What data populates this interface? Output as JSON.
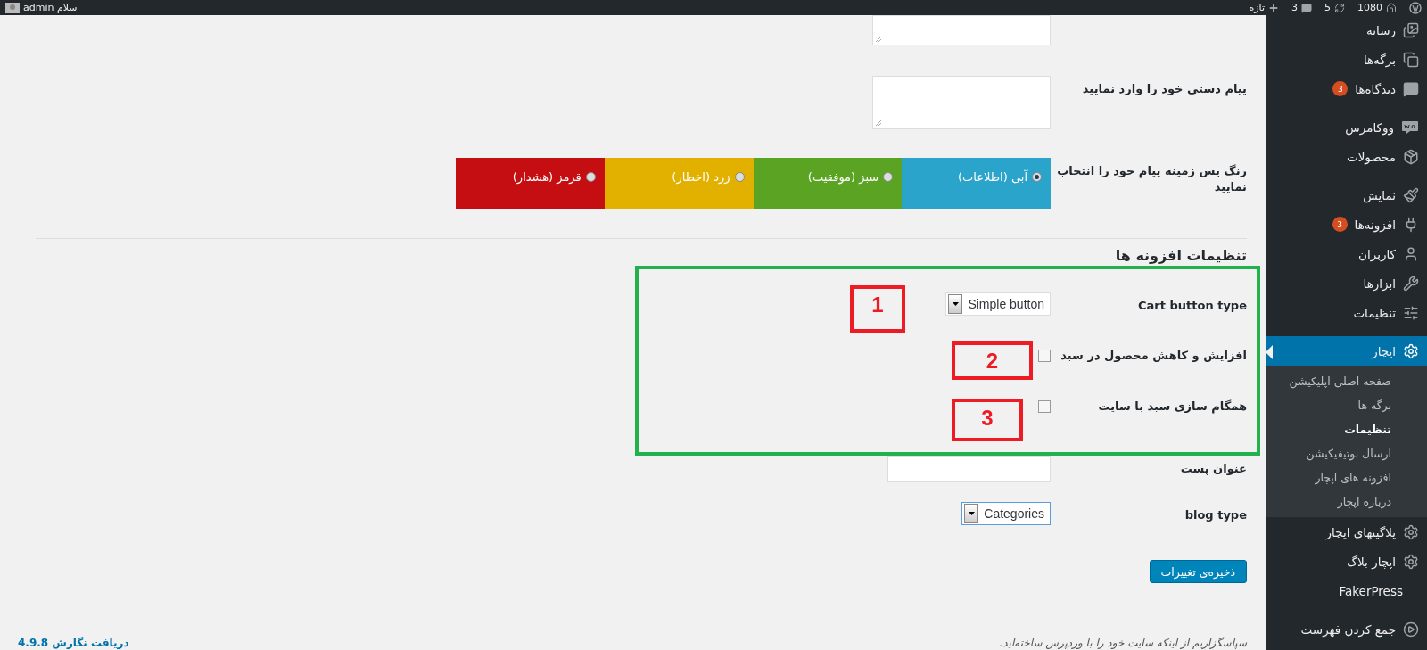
{
  "admin_bar": {
    "site": "1080",
    "updates": "5",
    "comments": "3",
    "new": "تازه",
    "greeting": "سلام admin"
  },
  "sidebar": {
    "groups": [
      {
        "items": [
          {
            "label": "رسانه",
            "selected": false
          },
          {
            "label": "برگه‌ها",
            "selected": false
          },
          {
            "label": "دیدگاه‌ها",
            "badge": "3",
            "selected": false
          }
        ]
      },
      {
        "items": [
          {
            "label": "ووکامرس",
            "selected": false
          },
          {
            "label": "محصولات",
            "selected": false
          }
        ]
      },
      {
        "items": [
          {
            "label": "نمایش",
            "selected": false
          },
          {
            "label": "افزونه‌ها",
            "badge": "3",
            "selected": false
          },
          {
            "label": "کاربران",
            "selected": false
          },
          {
            "label": "ابزارها",
            "selected": false
          },
          {
            "label": "تنظیمات",
            "selected": false
          }
        ]
      },
      {
        "items": [
          {
            "label": "اپچار",
            "selected": true,
            "children": [
              {
                "label": "صفحه اصلی اپلیکیشن",
                "selected": false
              },
              {
                "label": "برگه ها",
                "selected": false
              },
              {
                "label": "تنظیمات",
                "selected": true
              },
              {
                "label": "ارسال نوتیفیکیشن",
                "selected": false
              },
              {
                "label": "افزونه های اپچار",
                "selected": false
              },
              {
                "label": "درباره اپچار",
                "selected": false
              }
            ]
          },
          {
            "label": "پلاگینهای اپچار",
            "selected": false
          },
          {
            "label": "اپچار بلاگ",
            "selected": false
          },
          {
            "label": "FakerPress",
            "selected": false
          }
        ]
      }
    ],
    "collapse": "جمع کردن فهرست"
  },
  "form": {
    "message_label": "پیام دستی خود را وارد نمایید",
    "color_label": "رنگ پس زمینه پیام خود را انتخاب نمایید",
    "colors": [
      {
        "label": "آبی (اطلاعات)",
        "color": "#2ba4cc",
        "selected": true
      },
      {
        "label": "سبز (موفقیت)",
        "color": "#5ba423",
        "selected": false
      },
      {
        "label": "زرد (اخطار)",
        "color": "#e2b100",
        "selected": false
      },
      {
        "label": "قرمز (هشدار)",
        "color": "#c40e12",
        "selected": false
      }
    ],
    "section_title": "تنظیمات افزونه ها",
    "cart_label": "Cart button type",
    "cart_value": "Simple button",
    "checkboxes": [
      {
        "label": "افزایش و کاهش محصول در سبد",
        "checked": false
      },
      {
        "label": "همگام سازی سبد با سایت",
        "checked": false
      }
    ],
    "post_title_label": "عنوان پست",
    "blog_label": "blog type",
    "blog_value": "Categories",
    "save": "ذخیره‌ی تغییرات"
  },
  "annotations": [
    "1",
    "2",
    "3"
  ],
  "footer": {
    "thanks": "سپاسگزاریم از اینکه سایت خود را با وردپرس ساخته‌اید.",
    "version": "دریافت نگارش 4.9.8"
  }
}
